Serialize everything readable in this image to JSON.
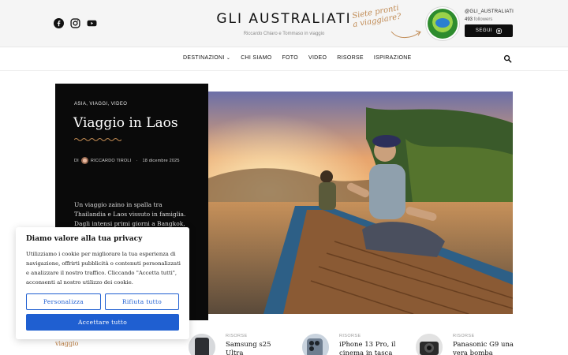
{
  "header": {
    "site_title": "GLI AUSTRALIATI",
    "tagline": "Riccardo Chiaro e Tommaso in viaggio",
    "handwritten_note": "Siete pronti a viaggiare?",
    "instagram_handle": "@GLI_AUSTRALIATI",
    "followers_count": "493",
    "followers_label": "followers",
    "follow_button": "SEGUI",
    "social_icons": [
      "facebook-icon",
      "instagram-icon",
      "youtube-icon"
    ]
  },
  "nav": {
    "items": [
      "DESTINAZIONI",
      "CHI SIAMO",
      "FOTO",
      "VIDEO",
      "RISORSE",
      "ISPIRAZIONE"
    ],
    "dropdown_indicator": "⌄",
    "search_icon": "search-icon"
  },
  "hero": {
    "categories": "ASIA,  VIAGGI,  VIDEO",
    "title": "Viaggio in Laos",
    "by": "DI",
    "author": "RICCARDO TIROLI",
    "date": "18 dicembre 2025",
    "excerpt": "Un viaggio zaino in spalla tra Thailandia e Laos vissuto in famiglia. Dagli intensi primi giorni a Bangkok, tra mercato del"
  },
  "cookie": {
    "heading": "Diamo valore alla tua privacy",
    "body": "Utilizziamo i cookie per migliorare la tua esperienza di navigazione, offrirti pubblicità o contenuti personalizzati e analizzare il nostro traffico. Cliccando \"Accetta tutti\", acconsenti al nostro utilizzo dei cookie.",
    "customize": "Personalizza",
    "reject": "Rifiuta tutto",
    "accept": "Accettare tutto"
  },
  "below": {
    "left_text": "viaggio"
  },
  "related": [
    {
      "label": "RISORSE",
      "title": "Samsung s25 Ultra"
    },
    {
      "label": "RISORSE",
      "title": "iPhone 13 Pro, il cinema in tasca"
    },
    {
      "label": "RISORSE",
      "title": "Panasonic G9 una vera bomba"
    }
  ],
  "colors": {
    "accent_blue": "#1f5fd1",
    "hero_black": "#0a0a0a",
    "hand_note": "#c08a53"
  }
}
